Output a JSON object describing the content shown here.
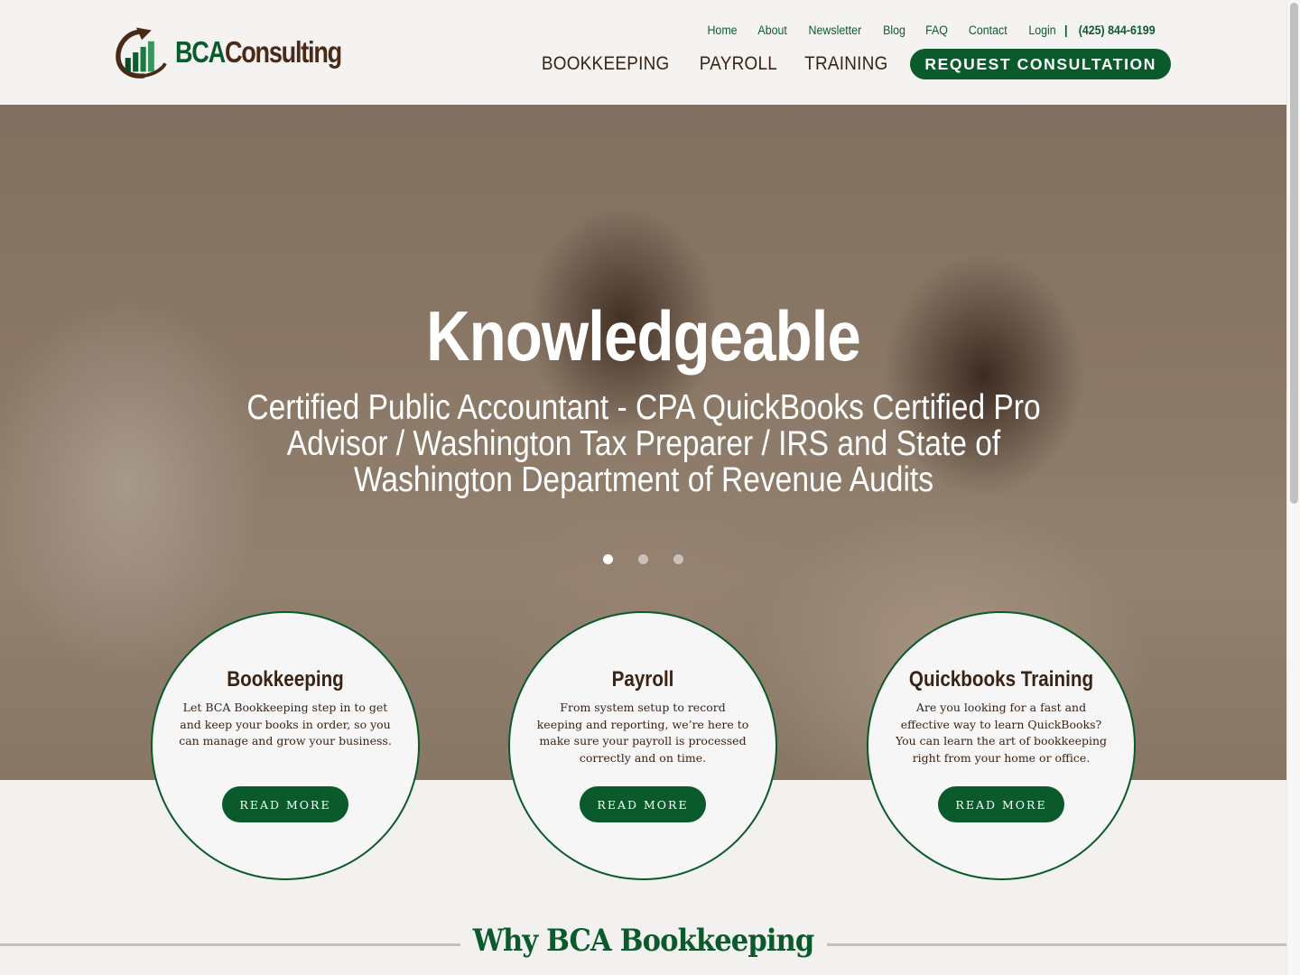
{
  "logo": {
    "bca": "BCA",
    "consulting": "Consulting"
  },
  "top_links": [
    {
      "label": "Home"
    },
    {
      "label": "About"
    },
    {
      "label": "Newsletter"
    },
    {
      "label": "Blog"
    },
    {
      "label": "FAQ"
    },
    {
      "label": "Contact"
    },
    {
      "label": "Login"
    }
  ],
  "separator": "|",
  "phone": "(425) 844-6199",
  "main_nav": [
    {
      "label": "BOOKKEEPING"
    },
    {
      "label": "PAYROLL"
    },
    {
      "label": "TRAINING"
    }
  ],
  "cta_label": "REQUEST CONSULTATION",
  "hero": {
    "title": "Knowledgeable",
    "subtitle": "Certified Public Accountant - CPA QuickBooks Certified Pro Advisor / Washington Tax Preparer / IRS and State of Washington Department of Revenue Audits",
    "slides_total": 3,
    "active_slide": 1
  },
  "cards": [
    {
      "title": "Bookkeeping",
      "text": "Let BCA Bookkeeping step in to get and keep your books in order, so you can manage and grow your business.",
      "button": "READ MORE"
    },
    {
      "title": "Payroll",
      "text": "From system setup to record keeping and reporting, we’re here to make sure your payroll is processed correctly and on time.",
      "button": "READ MORE"
    },
    {
      "title": "Quickbooks Training",
      "text": "Are you looking for a fast and effective way to learn QuickBooks? You can learn the art of bookkeeping right from your home or office.",
      "button": "READ MORE"
    }
  ],
  "why_heading": "Why BCA Bookkeeping",
  "colors": {
    "brand_green": "#0a5a2c",
    "brand_brown": "#3b2314",
    "page_bg": "#f2f1f0"
  }
}
